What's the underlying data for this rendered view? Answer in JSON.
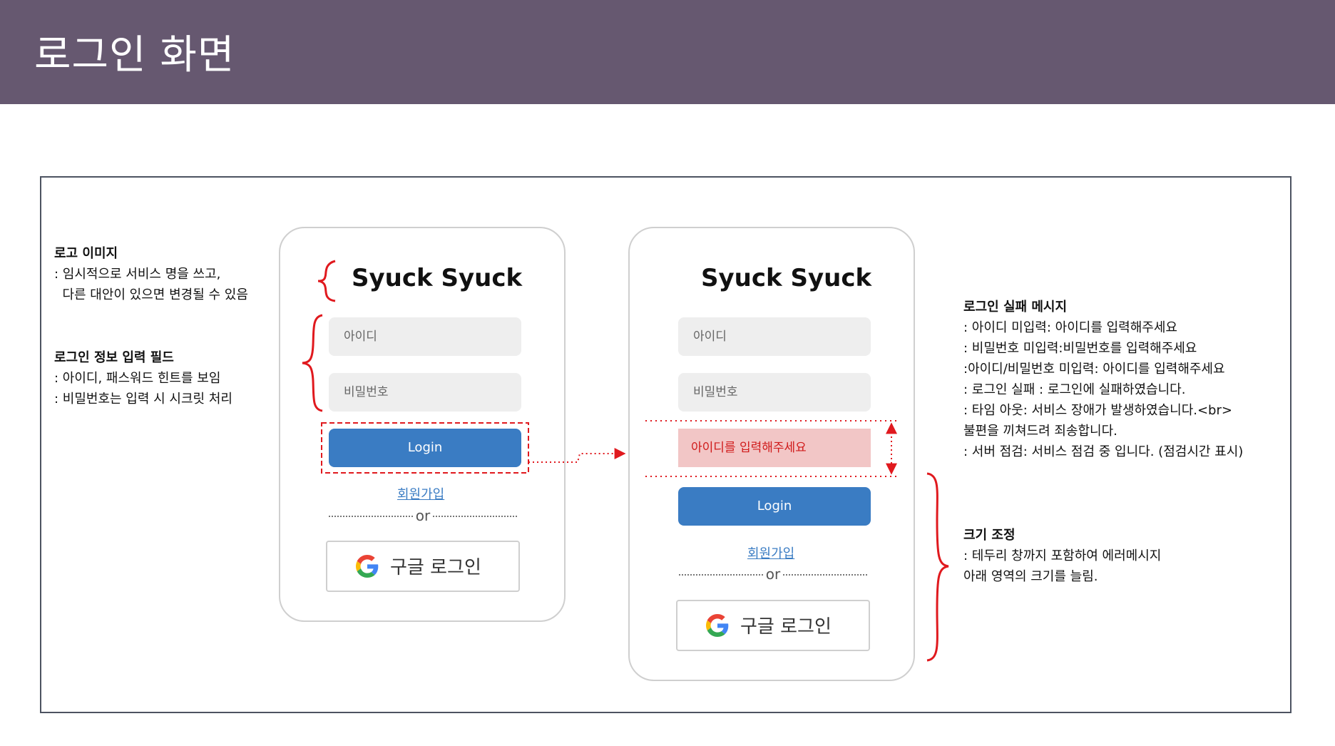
{
  "page": {
    "title": "로그인 화면"
  },
  "colors": {
    "header_bg": "#665870",
    "accent_blue": "#3a7cc3",
    "annotation_red": "#e0191e",
    "error_bg": "#f2c6c6"
  },
  "notes": {
    "logo": {
      "title": "로고 이미지",
      "lines": [
        ": 임시적으로 서비스 명을 쓰고,",
        "  다른 대안이 있으면 변경될 수 있음"
      ]
    },
    "fields": {
      "title": "로그인 정보 입력 필드",
      "lines": [
        ": 아이디, 패스워드 힌트를 보임",
        ": 비밀번호는 입력 시 시크릿 처리"
      ]
    },
    "fail": {
      "title": "로그인 실패 메시지",
      "lines": [
        ": 아이디 미입력: 아이디를 입력해주세요",
        ": 비밀번호 미입력:비밀번호를 입력해주세요",
        ":아이디/비밀번호 미입력: 아이디를 입력해주세요",
        ": 로그인 실패 : 로그인에 실패하였습니다.",
        ": 타임 아웃: 서비스 장애가 발생하였습니다.<br>",
        "불편을 끼쳐드려 죄송합니다.",
        ": 서버 점검: 서비스 점검 중 입니다. (점검시간 표시)"
      ]
    },
    "resize": {
      "title": "크기 조정",
      "lines": [
        ": 테두리 창까지 포함하여 에러메시지",
        "아래 영역의 크기를 늘림."
      ]
    }
  },
  "screen_default": {
    "logo": "Syuck Syuck",
    "id_placeholder": "아이디",
    "pw_placeholder": "비밀번호",
    "login_label": "Login",
    "signup_label": "회원가입",
    "or_label": "or",
    "google_label": "구글 로그인",
    "google_icon": "google-g-icon"
  },
  "screen_error": {
    "logo": "Syuck Syuck",
    "id_placeholder": "아이디",
    "pw_placeholder": "비밀번호",
    "error_message": "아이디를 입력해주세요",
    "login_label": "Login",
    "signup_label": "회원가입",
    "or_label": "or",
    "google_label": "구글 로그인",
    "google_icon": "google-g-icon"
  }
}
